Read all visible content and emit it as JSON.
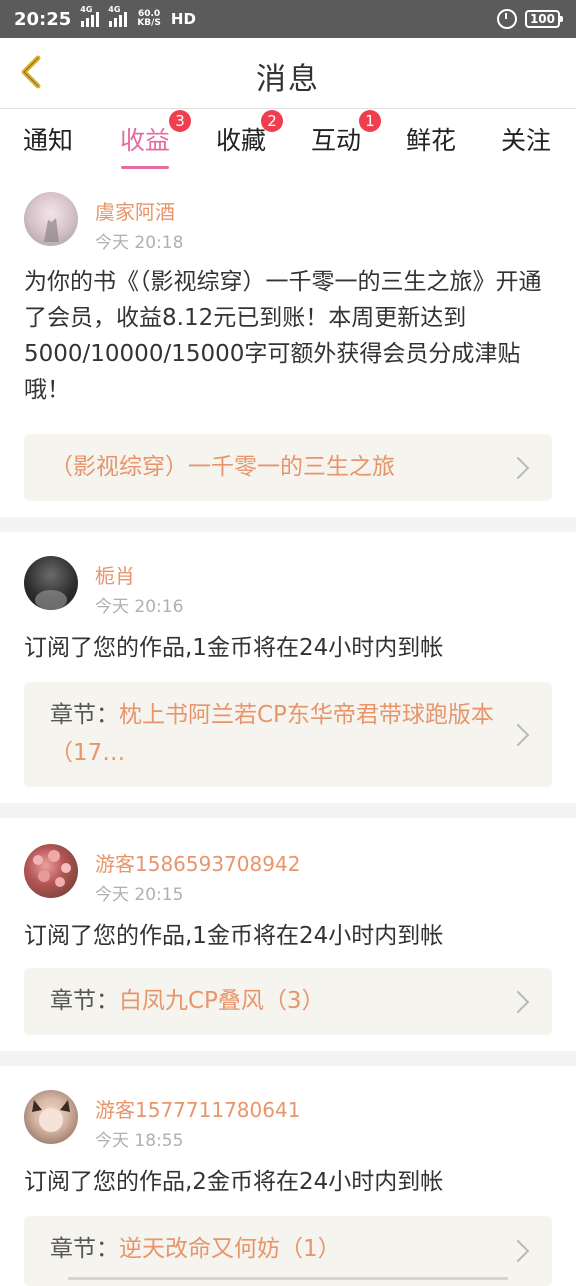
{
  "status_bar": {
    "time": "20:25",
    "net1": "4G",
    "net2": "4G",
    "speed_value": "60.0",
    "speed_unit": "KB/S",
    "hd": "HD",
    "battery": "100"
  },
  "header": {
    "title": "消息"
  },
  "tabs": [
    {
      "label": "通知",
      "badge": ""
    },
    {
      "label": "收益",
      "badge": "3"
    },
    {
      "label": "收藏",
      "badge": "2"
    },
    {
      "label": "互动",
      "badge": "1"
    },
    {
      "label": "鲜花",
      "badge": ""
    },
    {
      "label": "关注",
      "badge": ""
    }
  ],
  "messages": [
    {
      "name": "虞家阿酒",
      "time": "今天 20:18",
      "text": "为你的书《（影视综穿）一千零一的三生之旅》开通了会员，收益8.12元已到账！本周更新达到5000/10000/15000字可额外获得会员分成津贴哦！",
      "card_prefix": "",
      "card_title": "（影视综穿）一千零一的三生之旅"
    },
    {
      "name": "栀肖",
      "time": "今天 20:16",
      "text": "订阅了您的作品,1金币将在24小时内到帐",
      "card_prefix": "章节：",
      "card_title": "枕上书阿兰若CP东华帝君带球跑版本（17…"
    },
    {
      "name": "游客1586593708942",
      "time": "今天 20:15",
      "text": "订阅了您的作品,1金币将在24小时内到帐",
      "card_prefix": "章节：",
      "card_title": "白凤九CP叠风（3）"
    },
    {
      "name": "游客1577711780641",
      "time": "今天 18:55",
      "text": "订阅了您的作品,2金币将在24小时内到帐",
      "card_prefix": "章节：",
      "card_title": "逆天改命又何妨（1）"
    }
  ],
  "colors": {
    "accent": "#e46da0",
    "badge": "#f03e4f",
    "name": "#e8956c",
    "card_bg": "#f5f4ee"
  }
}
